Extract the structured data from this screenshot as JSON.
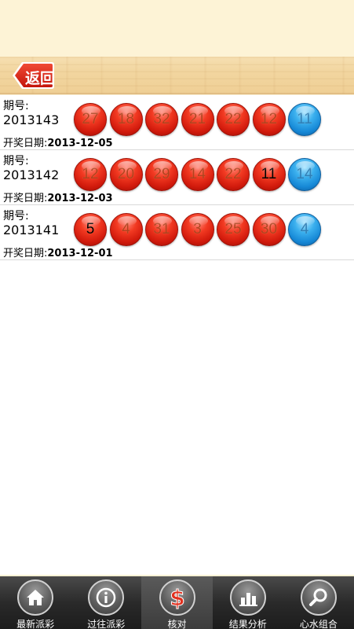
{
  "header": {
    "back_label": "返回"
  },
  "draws": [
    {
      "issue_label": "期号:",
      "issue": "2013143",
      "date_label": "开奖日期:",
      "date": "2013-12-05",
      "balls": [
        {
          "n": "27",
          "color": "red",
          "hit": false
        },
        {
          "n": "18",
          "color": "red",
          "hit": false
        },
        {
          "n": "32",
          "color": "red",
          "hit": false
        },
        {
          "n": "21",
          "color": "red",
          "hit": false
        },
        {
          "n": "22",
          "color": "red",
          "hit": false
        },
        {
          "n": "12",
          "color": "red",
          "hit": false
        },
        {
          "n": "11",
          "color": "blue",
          "hit": false
        }
      ]
    },
    {
      "issue_label": "期号:",
      "issue": "2013142",
      "date_label": "开奖日期:",
      "date": "2013-12-03",
      "balls": [
        {
          "n": "12",
          "color": "red",
          "hit": false
        },
        {
          "n": "20",
          "color": "red",
          "hit": false
        },
        {
          "n": "29",
          "color": "red",
          "hit": false
        },
        {
          "n": "14",
          "color": "red",
          "hit": false
        },
        {
          "n": "22",
          "color": "red",
          "hit": false
        },
        {
          "n": "11",
          "color": "red",
          "hit": true
        },
        {
          "n": "14",
          "color": "blue",
          "hit": false
        }
      ]
    },
    {
      "issue_label": "期号:",
      "issue": "2013141",
      "date_label": "开奖日期:",
      "date": "2013-12-01",
      "balls": [
        {
          "n": "5",
          "color": "red",
          "hit": true
        },
        {
          "n": "4",
          "color": "red",
          "hit": false
        },
        {
          "n": "31",
          "color": "red",
          "hit": false
        },
        {
          "n": "3",
          "color": "red",
          "hit": false
        },
        {
          "n": "25",
          "color": "red",
          "hit": false
        },
        {
          "n": "30",
          "color": "red",
          "hit": false
        },
        {
          "n": "4",
          "color": "blue",
          "hit": false
        }
      ]
    }
  ],
  "tabs": [
    {
      "label": "最新派彩",
      "icon": "home-icon",
      "active": false
    },
    {
      "label": "过往派彩",
      "icon": "info-icon",
      "active": false
    },
    {
      "label": "核对",
      "icon": "dollar-icon",
      "active": true
    },
    {
      "label": "结果分析",
      "icon": "bar-chart-icon",
      "active": false
    },
    {
      "label": "心水组合",
      "icon": "magnifier-icon",
      "active": false
    }
  ],
  "colors": {
    "red_ball": "#e02a18",
    "blue_ball": "#2a9fe6",
    "tabbar": "#2a2a2a",
    "background": "#fdf3d6"
  }
}
